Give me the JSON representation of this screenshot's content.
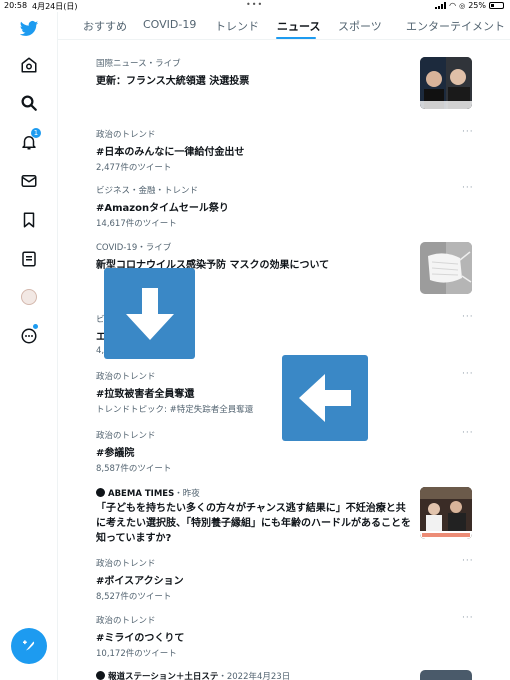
{
  "status_bar": {
    "time": "20:58",
    "date": "4月24日(日)",
    "battery": "25%"
  },
  "tabs": [
    {
      "label": "おすすめ",
      "active": false
    },
    {
      "label": "COVID-19",
      "active": false
    },
    {
      "label": "トレンド",
      "active": false
    },
    {
      "label": "ニュース",
      "active": true
    },
    {
      "label": "スポーツ",
      "active": false
    },
    {
      "label": "エンターテイメント",
      "active": false
    }
  ],
  "sidebar": {
    "icons": [
      "twitter-logo-icon",
      "home-icon",
      "search-icon",
      "notifications-icon",
      "messages-icon",
      "bookmarks-icon",
      "lists-icon",
      "profile-avatar",
      "more-icon"
    ],
    "notification_count": "1"
  },
  "feed": [
    {
      "meta": "国際ニュース・ライブ",
      "title": "更新：フランス大統領選 決選投票",
      "sub": ""
    },
    {
      "meta": "政治のトレンド",
      "title": "#日本のみんなに一律給付金出せ",
      "sub": "2,477件のツイート"
    },
    {
      "meta": "ビジネス・金融・トレンド",
      "title": "#Amazonタイムセール祭り",
      "sub": "14,617件のツイート"
    },
    {
      "meta": "COVID-19・ライブ",
      "title": "新型コロナウイルス感染予防 マスクの効果について",
      "sub": ""
    },
    {
      "meta": "ビ",
      "title": "エ",
      "sub": "4,"
    },
    {
      "meta": "政治のトレンド",
      "title": "#拉致被害者全員奪還",
      "sub": "トレンドトピック: #特定失踪者全員奪還"
    },
    {
      "meta": "政治のトレンド",
      "title": "#参議院",
      "sub": "8,587件のツイート"
    },
    {
      "source": "ABEMA TIMES",
      "time": "・昨夜",
      "title": "「子どもを持ちたい多くの方々がチャンス逃す結果に」不妊治療と共に考えたい選択肢、「特別養子縁組」にも年齢のハードルがあることを知っていますか?"
    },
    {
      "meta": "政治のトレンド",
      "title": "#ボイスアクション",
      "sub": "8,527件のツイート"
    },
    {
      "meta": "政治のトレンド",
      "title": "#ミライのつくりて",
      "sub": "10,172件のツイート"
    },
    {
      "source": "報道ステーション＋土日ステ",
      "time": "・2022年4月23日"
    }
  ],
  "more_label": "···",
  "colors": {
    "accent": "#1d9bf0",
    "overlay_arrow": "#3a88c6"
  },
  "overlays": [
    "down-arrow",
    "left-arrow"
  ]
}
